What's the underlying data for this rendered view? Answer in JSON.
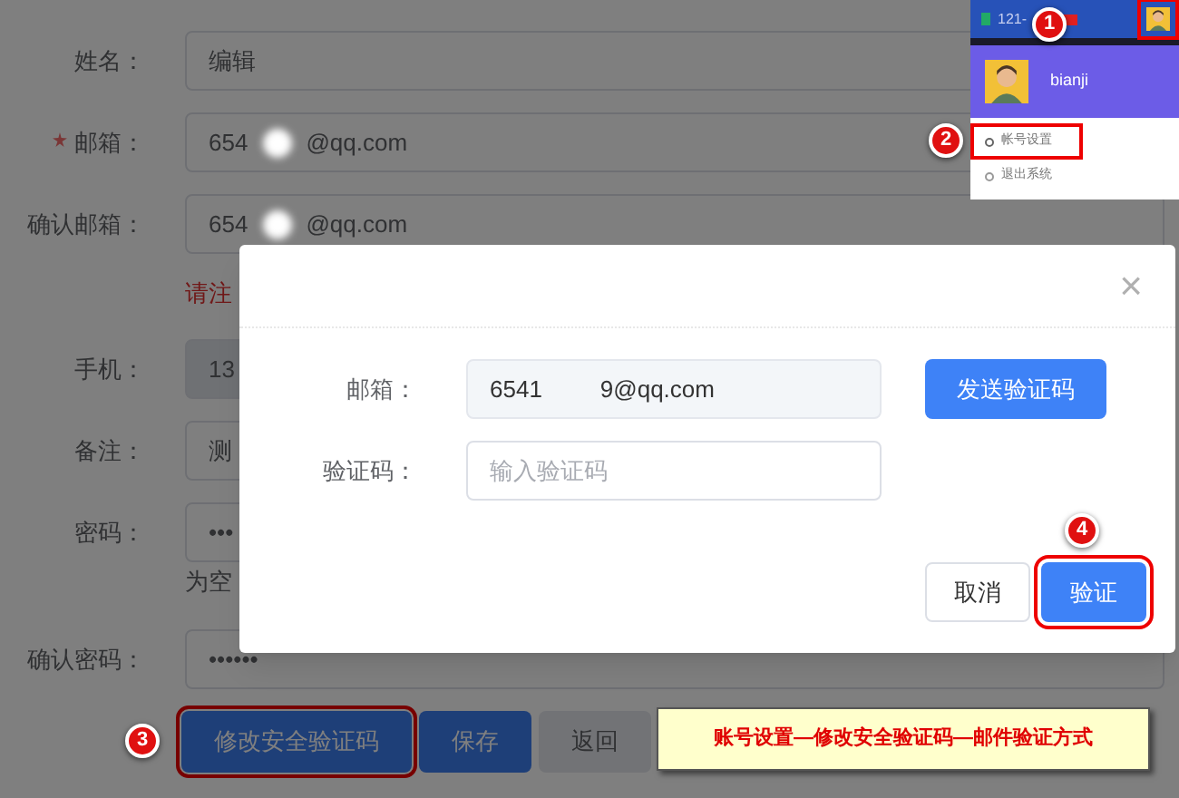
{
  "form": {
    "fields": [
      {
        "kind": "text",
        "label": "姓名：",
        "required": false,
        "disabled": false,
        "value": "编辑"
      },
      {
        "kind": "masked",
        "label": "邮箱：",
        "required": true,
        "value_start": "654",
        "value_end": "@qq.com"
      },
      {
        "kind": "masked",
        "label": "确认邮箱：",
        "required": false,
        "value_start": "654",
        "value_end": "@qq.com"
      },
      {
        "kind": "notice",
        "text": "请注"
      },
      {
        "kind": "text",
        "label": "手机：",
        "required": false,
        "disabled": true,
        "value": "13"
      },
      {
        "kind": "text",
        "label": "备注：",
        "required": false,
        "disabled": false,
        "value": "测"
      },
      {
        "kind": "password",
        "label": "密码：",
        "required": false,
        "value": "•••"
      },
      {
        "kind": "hint",
        "text": "为空"
      },
      {
        "kind": "password",
        "label": "确认密码：",
        "required": false,
        "value": "••••••"
      }
    ],
    "buttons": [
      {
        "label": "修改安全验证码",
        "kind": "primary",
        "outlined": true
      },
      {
        "label": "保存",
        "kind": "primary",
        "outlined": false
      },
      {
        "label": "返回",
        "kind": "default",
        "outlined": false
      }
    ]
  },
  "dialog": {
    "close": "×",
    "fields": [
      {
        "kind": "readonly",
        "label": "邮箱：",
        "value_start": "6541",
        "value_end": "9@qq.com"
      },
      {
        "kind": "input",
        "label": "验证码：",
        "placeholder": "输入验证码"
      }
    ],
    "send_button": "发送验证码",
    "buttons": [
      {
        "label": "取消",
        "kind": "default",
        "outlined": false
      },
      {
        "label": "验证",
        "kind": "primary",
        "outlined": true
      }
    ]
  },
  "inset": {
    "top_bar_text": "121-",
    "avatar_outlined": true,
    "user_name": "bianji",
    "menu": [
      {
        "label": "帐号设置",
        "kind": "settings",
        "outlined": true
      },
      {
        "label": "退出系统",
        "kind": "logout",
        "outlined": false
      }
    ]
  },
  "annotations": [
    {
      "number": "1"
    },
    {
      "number": "2"
    },
    {
      "number": "3"
    },
    {
      "number": "4"
    }
  ],
  "caption": "账号设置—修改安全验证码—邮件验证方式"
}
